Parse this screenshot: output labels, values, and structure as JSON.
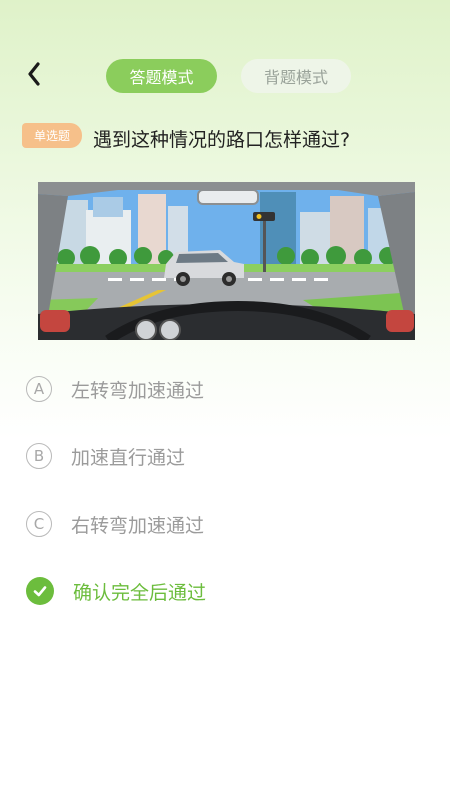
{
  "header": {
    "back_icon": "chevron-left-icon",
    "tabs": [
      {
        "label": "答题模式",
        "active": true
      },
      {
        "label": "背题模式",
        "active": false
      }
    ]
  },
  "question": {
    "type_badge": "单选题",
    "text": "遇到这种情况的路口怎样通过?",
    "image_icon": "intersection-scene-illustration"
  },
  "options": [
    {
      "letter": "A",
      "text": "左转弯加速通过",
      "correct": false
    },
    {
      "letter": "B",
      "text": "加速直行通过",
      "correct": false
    },
    {
      "letter": "C",
      "text": "右转弯加速通过",
      "correct": false
    },
    {
      "letter": "",
      "text": "确认完全后通过",
      "correct": true,
      "icon": "check-icon"
    }
  ],
  "colors": {
    "accent": "#8bcd5c",
    "correct": "#6cbd3d",
    "badge": "#f6c08a"
  }
}
